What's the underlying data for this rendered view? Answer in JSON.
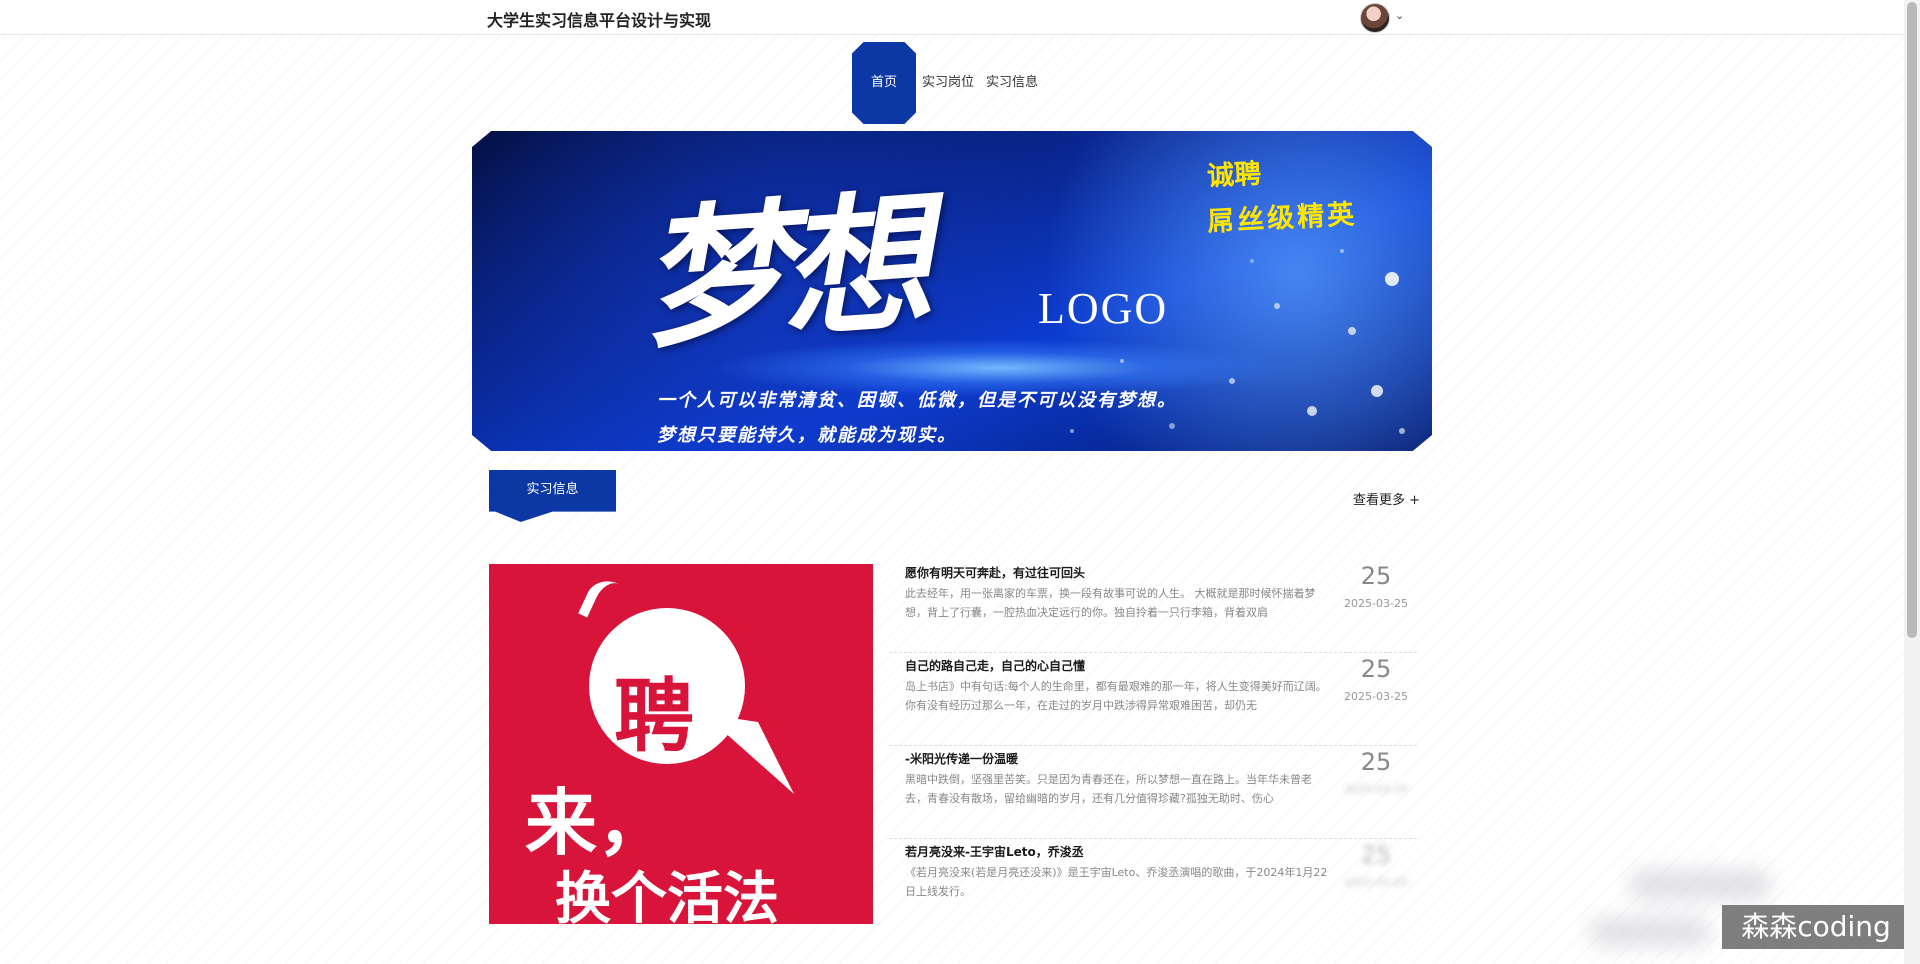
{
  "header": {
    "site_title": "大学生实习信息平台设计与实现",
    "avatar_icon": "user-avatar",
    "dropdown_icon": "chevron-down-icon"
  },
  "nav": {
    "items": [
      {
        "label": "首页",
        "active": true
      },
      {
        "label": "实习岗位",
        "active": false
      },
      {
        "label": "实习信息",
        "active": false
      }
    ]
  },
  "banner": {
    "headline": "梦想",
    "logo": "LOGO",
    "hire": "诚聘",
    "elite": "屌丝级精英",
    "line1": "一个人可以非常清贫、困顿、低微，但是不可以没有梦想。",
    "line2": "梦想只要能持久，就能成为现实。"
  },
  "section": {
    "title": "实习信息",
    "view_more": "查看更多 +"
  },
  "promo": {
    "pin": "聘",
    "come": "来，",
    "change": "换个活法"
  },
  "news": [
    {
      "title": "愿你有明天可奔赴，有过往可回头",
      "summary": "此去经年，用一张离家的车票，换一段有故事可说的人生。 大概就是那时候怀揣着梦想，背上了行囊，一腔热血决定远行的你。独自拎着一只行李箱，背着双肩",
      "day": "25",
      "date": "2025-03-25"
    },
    {
      "title": "自己的路自己走，自己的心自己懂",
      "summary": "岛上书店》中有句话:每个人的生命里，都有最艰难的那一年，将人生变得美好而辽阔。 你有没有经历过那么一年，在走过的岁月中跌涉得异常艰难困苦，却仍无",
      "day": "25",
      "date": "2025-03-25"
    },
    {
      "title": "-米阳光传递一份温暖",
      "summary": "黑暗中跌倒，坚强里苦笑。只是因为青春还在，所以梦想一直在路上。当年华未曾老去，青春没有散场，留给幽暗的岁月，还有几分值得珍藏?孤独无助时、伤心",
      "day": "25",
      "date": "2025-03-25"
    },
    {
      "title": "若月亮没来-王宇宙Leto，乔浚丞",
      "summary": "《若月亮没来(若是月亮还没来)》是王宇宙Leto、乔浚丞演唱的歌曲，于2024年1月22日上线发行。",
      "day": "25",
      "date": "2025-03-25"
    }
  ],
  "watermark": "森森coding"
}
